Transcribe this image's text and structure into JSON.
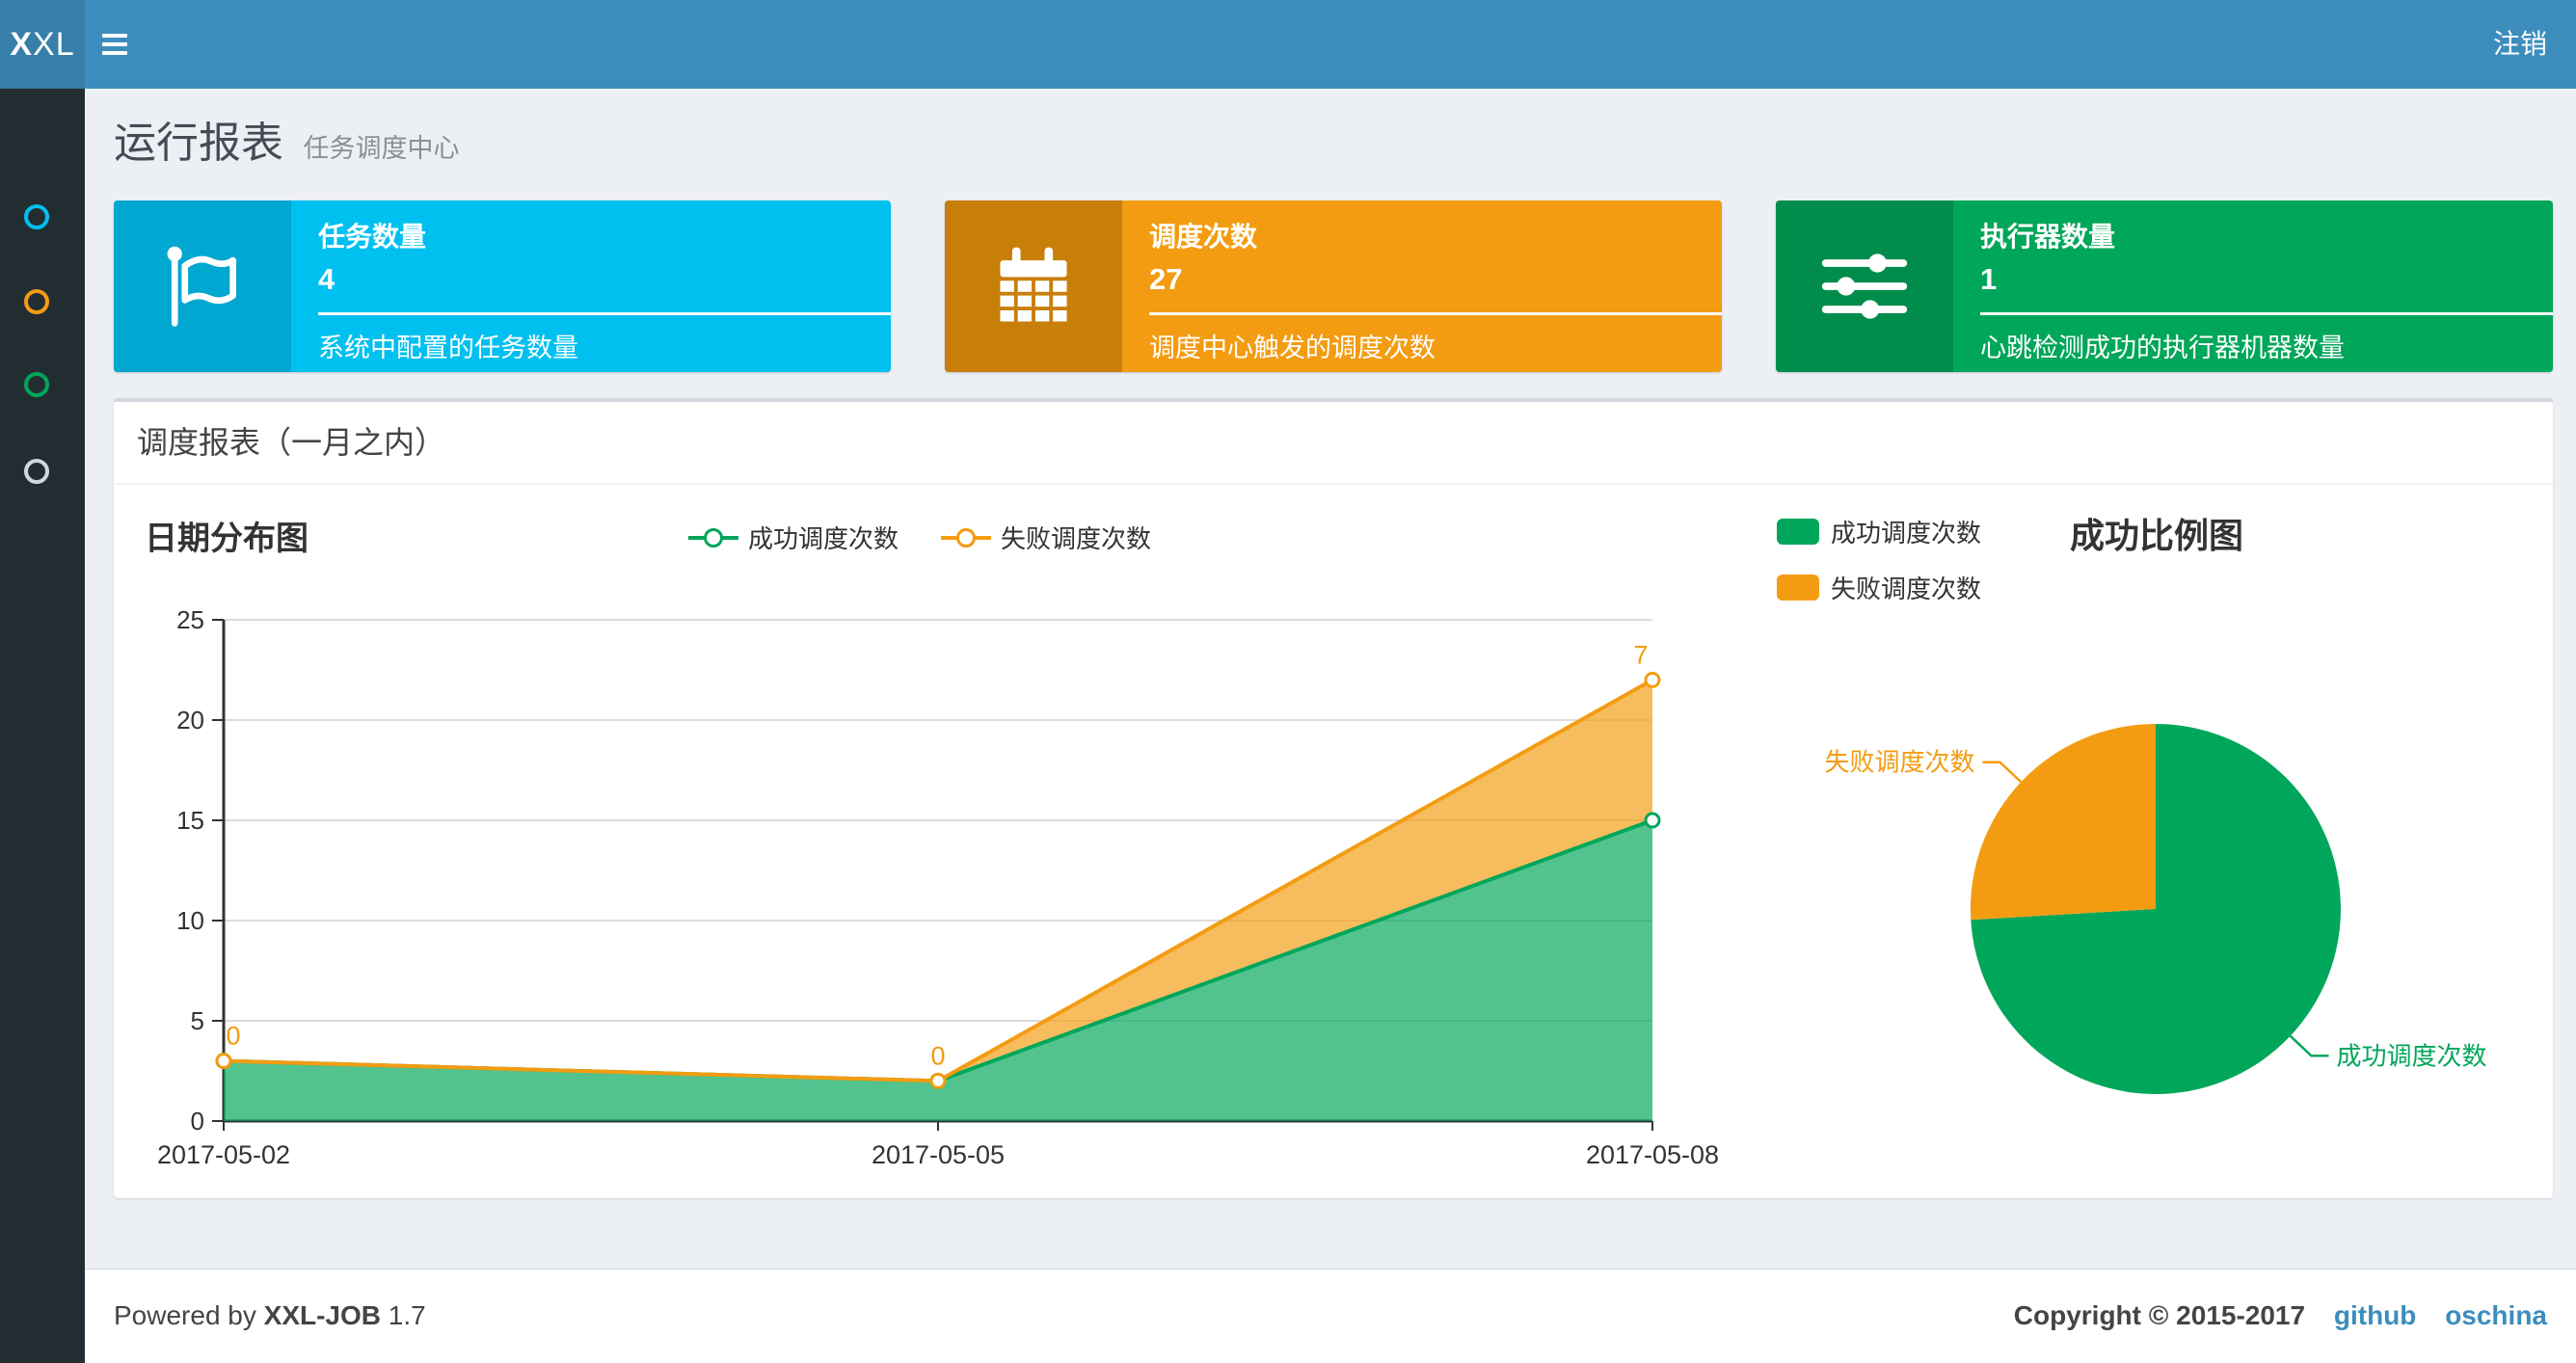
{
  "header": {
    "logo_bold": "X",
    "logo_rest": "XL",
    "logout_label": "注销"
  },
  "sidebar": {
    "items": [
      {
        "name": "menu-dashboard",
        "color": "#00c0ef"
      },
      {
        "name": "menu-jobinfo",
        "color": "#f39c12"
      },
      {
        "name": "menu-joblog",
        "color": "#00a65a"
      },
      {
        "name": "menu-help",
        "color": "#d2d6de"
      }
    ]
  },
  "page": {
    "title": "运行报表",
    "subtitle": "任务调度中心"
  },
  "cards": [
    {
      "title": "任务数量",
      "value": "4",
      "description": "系统中配置的任务数量",
      "color": "#00c0ef",
      "icon_color": "#00a7d0",
      "icon": "flag-icon"
    },
    {
      "title": "调度次数",
      "value": "27",
      "description": "调度中心触发的调度次数",
      "color": "#f39c12",
      "icon_color": "#c87f0a",
      "icon": "calendar-icon"
    },
    {
      "title": "执行器数量",
      "value": "1",
      "description": "心跳检测成功的执行器机器数量",
      "color": "#00a65a",
      "icon_color": "#008d4c",
      "icon": "sliders-icon"
    }
  ],
  "panel": {
    "title": "调度报表（一月之内）"
  },
  "chart_data": [
    {
      "type": "area",
      "title": "日期分布图",
      "stacked": true,
      "x": [
        "2017-05-02",
        "2017-05-05",
        "2017-05-08"
      ],
      "series": [
        {
          "name": "成功调度次数",
          "values": [
            3,
            2,
            15
          ],
          "color": "#00a65a"
        },
        {
          "name": "失败调度次数",
          "values": [
            0,
            0,
            7
          ],
          "color": "#f39c12"
        }
      ],
      "visible_point_labels": [
        "0",
        "0",
        "7"
      ],
      "ylim": [
        0,
        25
      ],
      "yticks": [
        0,
        5,
        10,
        15,
        20,
        25
      ],
      "grid": true,
      "legend_position": "top-center"
    },
    {
      "type": "pie",
      "title": "成功比例图",
      "slices": [
        {
          "label": "成功调度次数",
          "value": 20,
          "color": "#00a65a"
        },
        {
          "label": "失败调度次数",
          "value": 7,
          "color": "#f39c12"
        }
      ],
      "legend_position": "top-left"
    }
  ],
  "footer": {
    "powered_prefix": "Powered by",
    "brand": "XXL-JOB",
    "version": "1.7",
    "copyright": "Copyright © 2015-2017",
    "link_color": "#3c8dbc",
    "links": [
      {
        "label": "github"
      },
      {
        "label": "oschina"
      }
    ]
  }
}
